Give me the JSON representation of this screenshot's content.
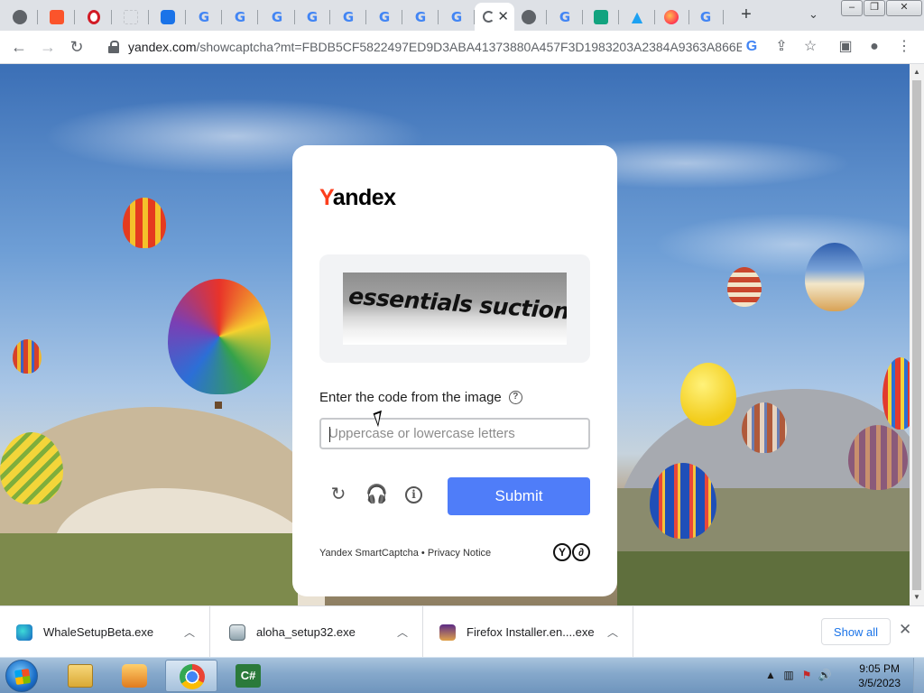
{
  "browser": {
    "tabs": [
      {
        "icon": "globe-icon"
      },
      {
        "icon": "brave-icon"
      },
      {
        "icon": "opera-icon"
      },
      {
        "icon": "blank-page-icon"
      },
      {
        "icon": "ghost-app-icon"
      },
      {
        "icon": "google-icon"
      },
      {
        "icon": "google-icon"
      },
      {
        "icon": "google-icon"
      },
      {
        "icon": "google-icon"
      },
      {
        "icon": "google-icon"
      },
      {
        "icon": "google-icon"
      },
      {
        "icon": "google-icon"
      },
      {
        "icon": "google-icon"
      },
      {
        "icon": "loading-icon",
        "active": true
      },
      {
        "icon": "globe-icon"
      },
      {
        "icon": "google-icon"
      },
      {
        "icon": "feather-app-icon"
      },
      {
        "icon": "alpha-icon"
      },
      {
        "icon": "firefox-icon"
      },
      {
        "icon": "google-icon"
      }
    ],
    "url_host": "yandex.com",
    "url_path": "/showcaptcha?mt=FBDB5CF5822497ED9D3ABA41373880A457F3D1983203A2384A9363A866B..."
  },
  "captcha": {
    "logo_first_letter": "Y",
    "logo_rest": "andex",
    "image_text": "essentials suction",
    "prompt_label": "Enter the code from the image",
    "help_glyph": "?",
    "input_placeholder": "Uppercase or lowercase letters",
    "input_value": "",
    "submit_label": "Submit",
    "footer_product": "Yandex SmartCaptcha",
    "footer_separator": "•",
    "footer_privacy": "Privacy Notice",
    "brand_marks": [
      "Y",
      "∂"
    ],
    "accent_color": "#4f7df9",
    "logo_red": "#fc3f1d"
  },
  "downloads": {
    "items": [
      {
        "name": "WhaleSetupBeta.exe",
        "icon": "whale-icon"
      },
      {
        "name": "aloha_setup32.exe",
        "icon": "installer-icon"
      },
      {
        "name": "Firefox Installer.en....exe",
        "icon": "firefox-installer-icon"
      }
    ],
    "show_all_label": "Show all"
  },
  "taskbar": {
    "apps": [
      {
        "name": "file-explorer",
        "icon": "folder-icon"
      },
      {
        "name": "media-player",
        "icon": "media-player-icon"
      },
      {
        "name": "chrome",
        "icon": "chrome-icon",
        "active": true
      },
      {
        "name": "csharp",
        "icon": "csharp-icon"
      }
    ],
    "csharp_label": "C#",
    "time": "9:05 PM",
    "date": "3/5/2023"
  }
}
